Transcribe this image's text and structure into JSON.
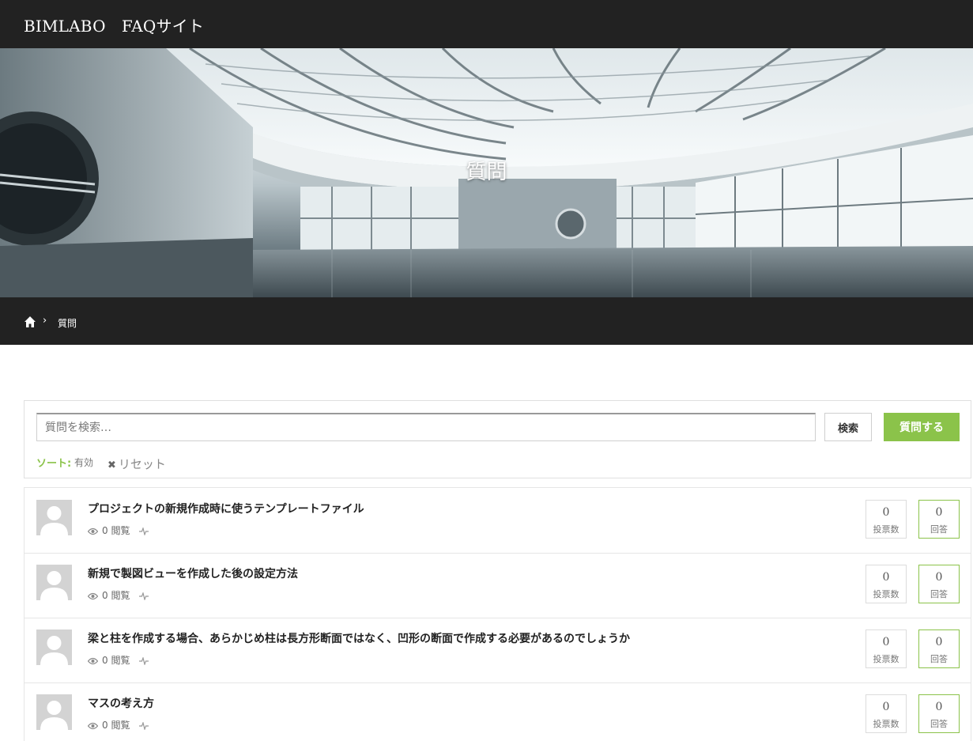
{
  "header": {
    "site_title": "BIMLABO　FAQサイト"
  },
  "hero": {
    "title": "質問"
  },
  "breadcrumb": {
    "home_icon": "home-icon",
    "separator": "›",
    "current": "質問"
  },
  "search": {
    "placeholder": "質問を検索…",
    "search_button": "検索",
    "ask_button": "質問する",
    "sort_label": "ソート:",
    "sort_value": "有効",
    "reset_label": "リセット"
  },
  "colors": {
    "accent": "#8bc34a",
    "dark_bar": "#222222"
  },
  "questions": [
    {
      "title": "プロジェクトの新規作成時に使うテンプレートファイル",
      "views": "0 閲覧",
      "votes": "0",
      "votes_label": "投票数",
      "answers": "0",
      "answers_label": "回答"
    },
    {
      "title": "新規で製図ビューを作成した後の設定方法",
      "views": "0 閲覧",
      "votes": "0",
      "votes_label": "投票数",
      "answers": "0",
      "answers_label": "回答"
    },
    {
      "title": "梁と柱を作成する場合、あらかじめ柱は長方形断面ではなく、凹形の断面で作成する必要があるのでしょうか",
      "views": "0 閲覧",
      "votes": "0",
      "votes_label": "投票数",
      "answers": "0",
      "answers_label": "回答"
    },
    {
      "title": "マスの考え方",
      "views": "0 閲覧",
      "votes": "0",
      "votes_label": "投票数",
      "answers": "0",
      "answers_label": "回答"
    }
  ]
}
